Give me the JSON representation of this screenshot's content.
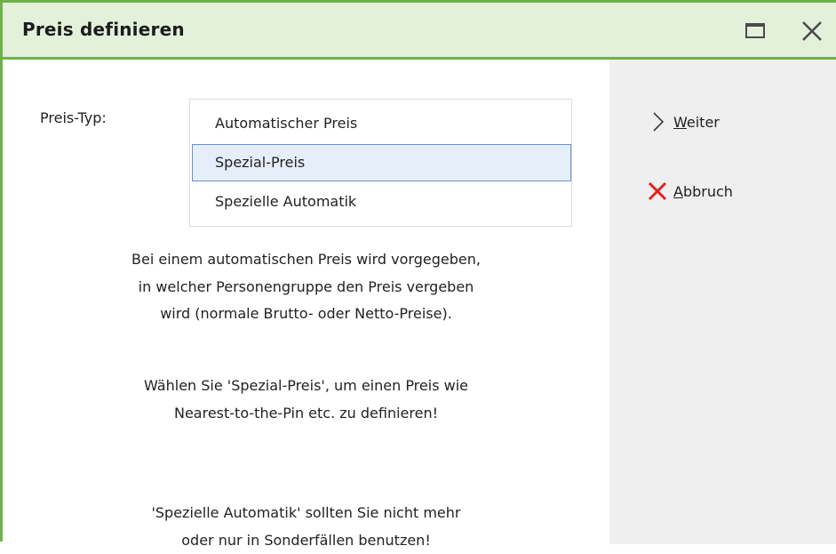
{
  "window": {
    "title": "Preis definieren",
    "accent_color": "#6fb04a",
    "titlebar_bg": "#e3f0da"
  },
  "form": {
    "preis_typ_label": "Preis-Typ:",
    "options": [
      {
        "label": "Automatischer Preis",
        "selected": false
      },
      {
        "label": "Spezial-Preis",
        "selected": true
      },
      {
        "label": "Spezielle Automatik",
        "selected": false
      }
    ]
  },
  "description": {
    "block1": [
      "Bei einem automatischen Preis wird vorgegeben,",
      "in welcher Personengruppe den Preis vergeben",
      "wird (normale Brutto- oder Netto-Preise)."
    ],
    "block2": [
      "Wählen Sie 'Spezial-Preis', um einen Preis wie",
      "Nearest-to-the-Pin etc. zu definieren!"
    ],
    "block3": [
      "'Spezielle Automatik' sollten Sie nicht mehr",
      "oder nur in Sonderfällen benutzen!"
    ]
  },
  "sidebar": {
    "weiter": {
      "mnemonic": "W",
      "rest": "eiter",
      "icon": "chevron-right-icon"
    },
    "abbruch": {
      "mnemonic": "A",
      "rest": "bbruch",
      "icon": "red-x-icon",
      "icon_color": "#e02020"
    }
  }
}
